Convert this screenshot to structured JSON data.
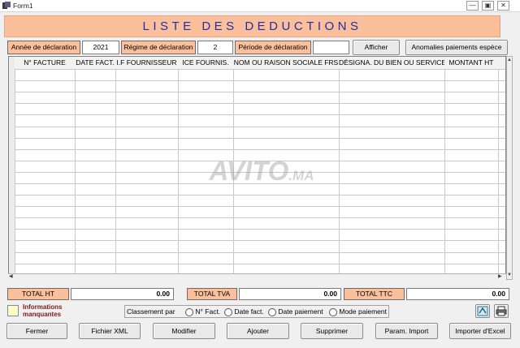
{
  "window": {
    "title": "Form1"
  },
  "header": {
    "title": "LISTE DES DEDUCTIONS"
  },
  "params": {
    "annee_label": "Année de déclaration",
    "annee_value": "2021",
    "regime_label": "Régime de déclaration",
    "regime_value": "2",
    "periode_label": "Période de déclaration",
    "periode_value": "",
    "afficher_button": "Afficher",
    "anomalies_button": "Anomalies paiements espèce"
  },
  "table": {
    "columns": [
      "N° FACTURE",
      "DATE FACT.",
      "I.F FOURNISSEUR",
      "ICE FOURNIS.",
      "NOM OU RAISON SOCIALE FRS",
      "DÉSIGNA. DU BIEN OU SERVICE",
      "MONTANT HT"
    ],
    "rows": []
  },
  "watermark": {
    "main": "AVITO",
    "suffix": ".MA"
  },
  "totals": {
    "ht_label": "TOTAL HT",
    "ht_value": "0.00",
    "tva_label": "TOTAL TVA",
    "tva_value": "0.00",
    "ttc_label": "TOTAL TTC",
    "ttc_value": "0.00"
  },
  "legend": {
    "label": "Informations manquantes",
    "color": "#ffffc8"
  },
  "sort": {
    "label": "Classement par",
    "options": [
      "N° Fact.",
      "Date fact.",
      "Date paiement",
      "Mode paiement"
    ]
  },
  "footer": {
    "fermer": "Fermer",
    "xml": "Fichier XML",
    "modifier": "Modifier",
    "ajouter": "Ajouter",
    "supprimer": "Supprimer",
    "param_import": "Param. Import",
    "importer_excel": "Importer d'Excel"
  },
  "colors": {
    "accent": "#fbbf9c",
    "title_text": "#1f2fa6"
  }
}
